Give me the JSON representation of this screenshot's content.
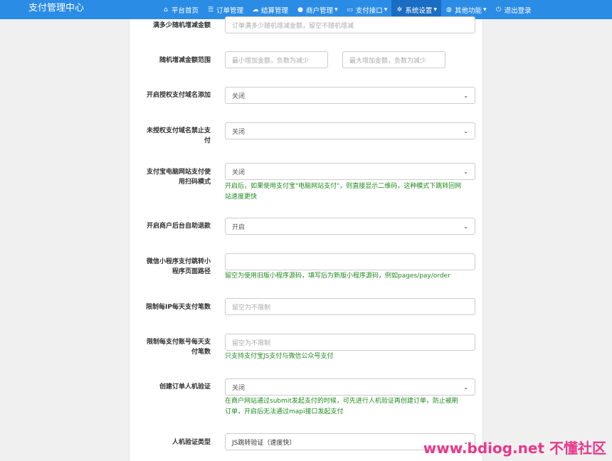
{
  "brand": "支付管理中心",
  "nav": [
    {
      "icon": "home-icon",
      "glyph": "⌂",
      "label": "平台首页",
      "dropdown": false,
      "active": false
    },
    {
      "icon": "list-icon",
      "glyph": "☰",
      "label": "订单管理",
      "dropdown": false,
      "active": false
    },
    {
      "icon": "cloud-icon",
      "glyph": "☁",
      "label": "结算管理",
      "dropdown": false,
      "active": false
    },
    {
      "icon": "user-icon",
      "glyph": "●",
      "label": "商户管理",
      "dropdown": true,
      "active": false
    },
    {
      "icon": "card-icon",
      "glyph": "▭",
      "label": "支付接口",
      "dropdown": true,
      "active": false
    },
    {
      "icon": "gear-icon",
      "glyph": "✲",
      "label": "系统设置",
      "dropdown": true,
      "active": true
    },
    {
      "icon": "globe-icon",
      "glyph": "◍",
      "label": "其他功能",
      "dropdown": true,
      "active": false
    },
    {
      "icon": "power-icon",
      "glyph": "⏻",
      "label": "退出登录",
      "dropdown": false,
      "active": false
    }
  ],
  "form": {
    "random_threshold": {
      "label": "满多少随机增减金额",
      "placeholder": "订单满多少随机增减金额，留空不随机增减"
    },
    "random_range": {
      "label": "随机增减金额范围",
      "min_placeholder": "最小增加金额，负数为减少",
      "max_placeholder": "最大增加金额，负数为减少"
    },
    "auth_domain_add": {
      "label": "开启授权支付域名添加",
      "value": "关闭"
    },
    "unauth_domain_block": {
      "label_line1": "未授权支付域名禁止支",
      "label_line2": "付",
      "value": "关闭"
    },
    "alipay_pc_qrcode": {
      "label_line1": "支付宝电脑网站支付使",
      "label_line2": "用扫码模式",
      "value": "关闭",
      "help_line1": "开启后，如果使用支付宝\"电脑网站支付\"，则直接显示二维码，这种模式下跳转回网",
      "help_line2": "站速度更快"
    },
    "merchant_refund": {
      "label": "开启商户后台自助退款",
      "value": "开启"
    },
    "wx_miniprogram_path": {
      "label_line1": "微信小程序支付跳转小",
      "label_line2": "程序页面路径",
      "value": "",
      "help": "留空为使用旧版小程序源码，填写后为新版小程序源码，例如pages/pay/order"
    },
    "ip_daily_limit": {
      "label": "限制每IP每天支付笔数",
      "placeholder": "留空为不限制"
    },
    "account_daily_limit": {
      "label_line1": "限制每支付账号每天支",
      "label_line2": "付笔数",
      "placeholder": "留空为不限制",
      "help": "只支持支付宝JS支付与微信公众号支付"
    },
    "order_captcha": {
      "label": "创建订单人机验证",
      "value": "关闭",
      "help_line1": "在商户网站通过submit发起支付的时候，可先进行人机验证再创建订单，防止被刷",
      "help_line2": "订单，开启后无法通过mapi接口发起支付"
    },
    "captcha_type": {
      "label": "人机验证类型",
      "value": "JS跳转验证（速度快）"
    }
  },
  "watermark": "www.bdiog.net 不懂社区"
}
